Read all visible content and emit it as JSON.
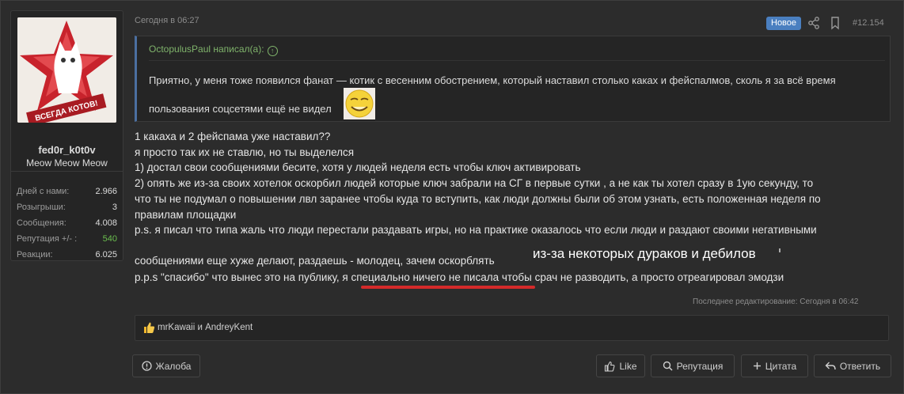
{
  "post": {
    "date": "Сегодня в 06:27",
    "badge": "Новое",
    "number": "#12.154",
    "edited": "Последнее редактирование: Сегодня в 06:42"
  },
  "user": {
    "name": "fed0r_k0t0v",
    "title": "Meow Meow Meow",
    "avatar_text": "ВСЕГДА КОТОВ!",
    "stats": [
      {
        "label": "Дней с нами:",
        "value": "2.966"
      },
      {
        "label": "Розыгрыши:",
        "value": "3"
      },
      {
        "label": "Сообщения:",
        "value": "4.008"
      },
      {
        "label": "Репутация +/- :",
        "value": "540"
      },
      {
        "label": "Реакции:",
        "value": "6.025"
      }
    ]
  },
  "quote": {
    "author": "OctopulusPaul написал(а):",
    "line1": "Приятно, у меня тоже появился фанат — котик с весенним обострением, который наставил столько каках и фейспалмов, сколь я за всё время",
    "line2": "пользования соцсетями ещё не видел"
  },
  "message": {
    "lines": [
      "1 какаха и 2 фейспама уже наставил??",
      "я просто так их не ставлю, но ты выделелся",
      "1) достал свои сообщениями бесите, хотя у людей неделя есть чтобы ключ активировать",
      "2) опять же из-за своих хотелок оскорбил людей которые ключ забрали на СГ в первые сутки , а не как ты хотел сразу в 1ую секунду, то",
      "что ты не подумал о повышении лвл заранее чтобы куда то вступить, как люди должны были об этом узнать, есть положенная неделя по",
      "правилам площадки",
      "p.s. я писал что типа жаль что люди перестали раздавать игры, но на практике оказалось что если люди и раздают своими негативными",
      "сообщениями еще хуже делают, раздаешь - молодец, зачем оскорблять",
      "p.p.s \"спасибо\" что вынес это на публику, я специально ничего не писала чтобы срач не разводить, а просто отреагировал эмодзи"
    ],
    "overlay": "из-за некоторых дураков и дебилов"
  },
  "reactions": {
    "text": "mrKawaii и AndreyKent"
  },
  "actions": {
    "report": "Жалоба",
    "like": "Like",
    "reputation": "Репутация",
    "quote": "Цитата",
    "reply": "Ответить"
  },
  "colors": {
    "badge": "#4a7fc0",
    "quote_author": "#7fb36b",
    "reputation_value": "#6bbf4e",
    "underline": "#d42a2a"
  }
}
